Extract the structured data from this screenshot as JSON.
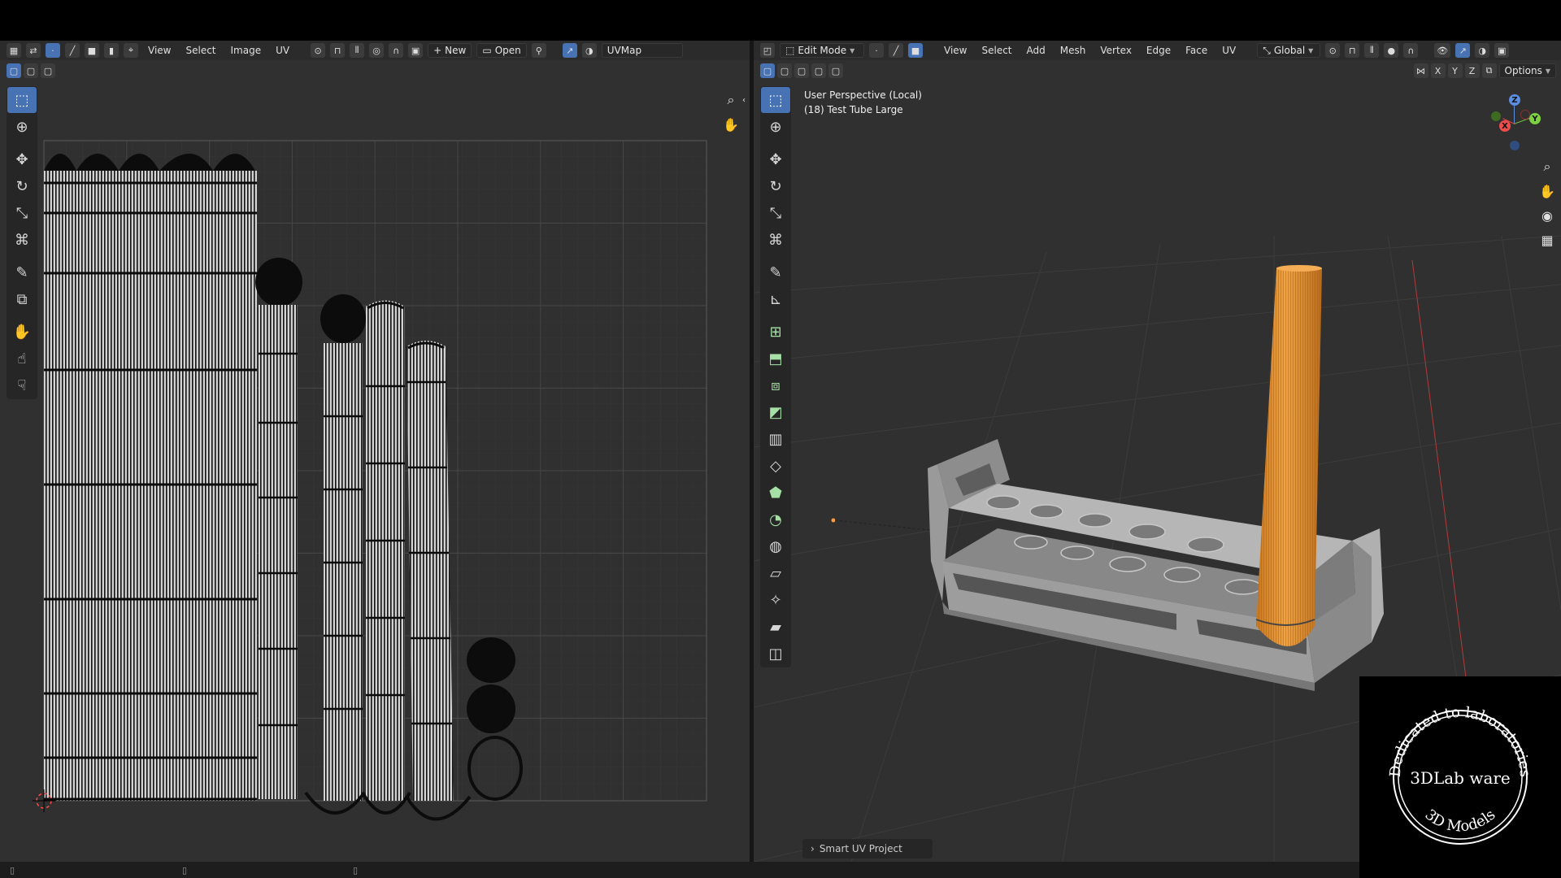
{
  "uv_editor": {
    "menus": [
      "View",
      "Select",
      "Image",
      "UV"
    ],
    "new_label": "New",
    "open_label": "Open",
    "uvmap_name": "UVMap"
  },
  "viewport": {
    "mode_label": "Edit Mode",
    "menus": [
      "View",
      "Select",
      "Add",
      "Mesh",
      "Vertex",
      "Edge",
      "Face",
      "UV"
    ],
    "orientation_label": "Global",
    "axis_labels": [
      "X",
      "Y",
      "Z"
    ],
    "options_label": "Options",
    "perspective_label": "User Perspective (Local)",
    "object_label": "(18) Test Tube Large",
    "last_operator": "Smart UV Project",
    "gizmo": {
      "z": "Z",
      "y": "Y",
      "x": "X"
    }
  },
  "watermark": {
    "top_text": "Dedicated to laboratories",
    "center_text": "3DLab ware",
    "bottom_text": "3D Models"
  },
  "colors": {
    "editor_bg": "#303030",
    "active_blue": "#4772b3",
    "tube_orange": "#e39334",
    "rack_gray": "#a7a7a7"
  }
}
